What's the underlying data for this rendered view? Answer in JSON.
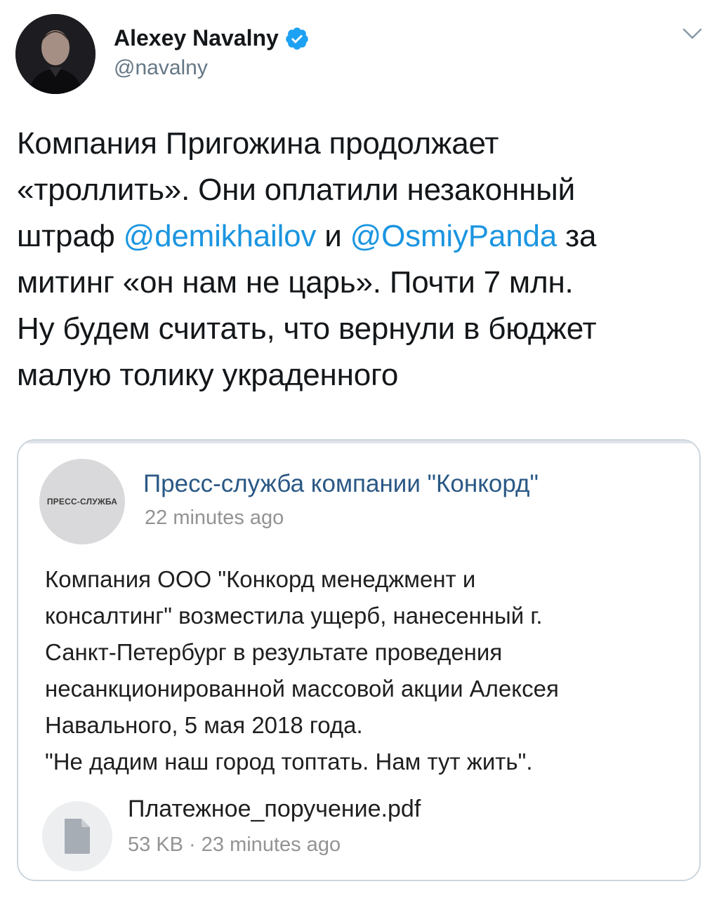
{
  "tweet": {
    "author_name": "Alexey Navalny",
    "author_handle": "@navalny",
    "verified": true,
    "menu_icon": "chevron-down-icon",
    "text": {
      "line1": "Компания Пригожина продолжает",
      "line2": "«троллить». Они оплатили незаконный",
      "line3_prefix": "штраф ",
      "mention1": "@demikhailov",
      "line3_middle": " и ",
      "mention2": "@OsmiyPanda",
      "line3_suffix": " за",
      "line4": "митинг «он нам не царь». Почти 7 млн.",
      "line5": "Ну будем считать, что вернули в бюджет",
      "line6": "малую толику украденного"
    },
    "accent_color": "#1b95e0"
  },
  "card": {
    "avatar_label": "ПРЕСС-СЛУЖБА",
    "title": "Пресс-служба компании \"Конкорд\"",
    "time": "22 minutes ago",
    "body": {
      "line1": "Компания ООО \"Конкорд менеджмент и",
      "line2": "консалтинг\" возместила ущерб, нанесенный г.",
      "line3": "Санкт-Петербург в результате проведения",
      "line4": "несанкционированной массовой акции Алексея",
      "line5": "Навального, 5 мая 2018 года.",
      "line6": "\"Не дадим наш город топтать. Нам тут жить\"."
    },
    "attachment": {
      "icon": "document-icon",
      "file_name": "Платежное_поручение.pdf",
      "meta": "53 KB · 23 minutes ago"
    },
    "title_color": "#2a5885"
  }
}
